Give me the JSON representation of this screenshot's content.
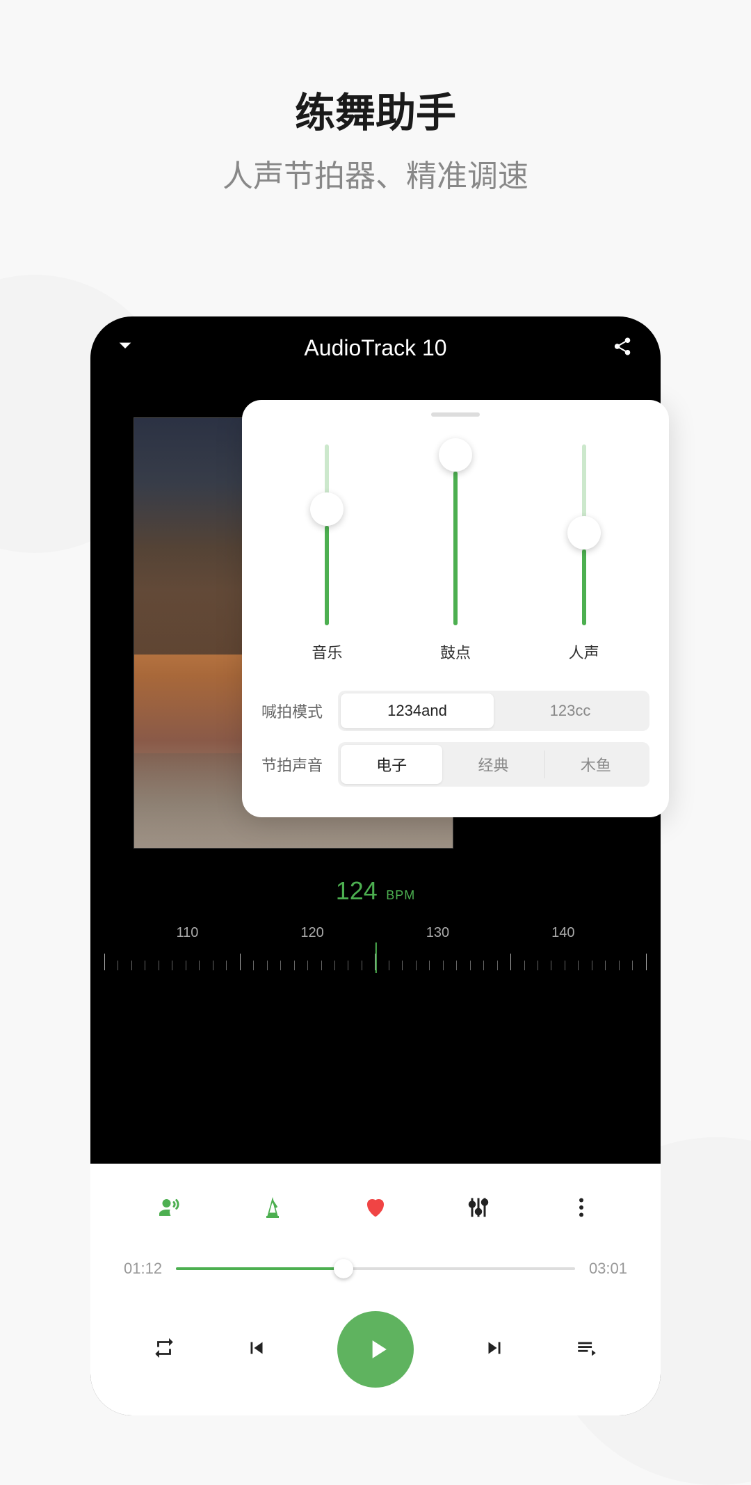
{
  "promo": {
    "title": "练舞助手",
    "subtitle": "人声节拍器、精准调速"
  },
  "player": {
    "track_title": "AudioTrack 10",
    "bpm": {
      "value": "124",
      "unit": "BPM",
      "ticks": [
        "110",
        "120",
        "130",
        "140"
      ]
    },
    "progress": {
      "elapsed": "01:12",
      "total": "03:01",
      "percent": 42
    }
  },
  "mixer": {
    "sliders": [
      {
        "label": "音乐",
        "value": 55
      },
      {
        "label": "鼓点",
        "value": 85
      },
      {
        "label": "人声",
        "value": 42
      }
    ],
    "count_mode": {
      "label": "喊拍模式",
      "options": [
        "1234and",
        "123cc"
      ],
      "selected": 0
    },
    "beat_sound": {
      "label": "节拍声音",
      "options": [
        "电子",
        "经典",
        "木鱼"
      ],
      "selected": 0
    }
  },
  "icons": {
    "voice": "voice-icon",
    "metronome": "metronome-icon",
    "heart": "heart-icon",
    "equalizer": "equalizer-icon",
    "more": "more-icon"
  }
}
